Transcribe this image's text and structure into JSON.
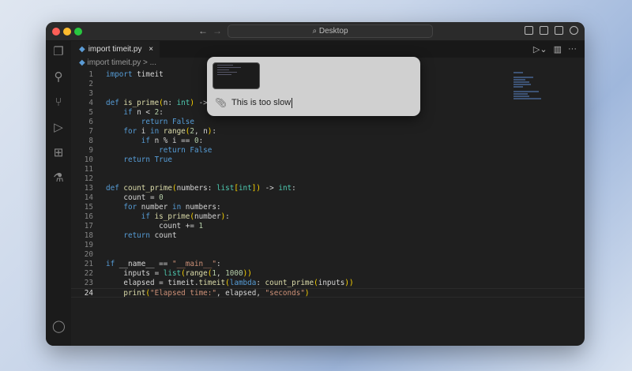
{
  "window": {
    "search": "Desktop"
  },
  "tab": {
    "label": "import timeit.py",
    "close": "×"
  },
  "breadcrumb": "import timeit.py > ...",
  "popup": {
    "input": "This is too slow"
  },
  "code": [
    [
      [
        "import ",
        "kw"
      ],
      [
        "timeit",
        "tx"
      ]
    ],
    [],
    [],
    [
      [
        "def ",
        "kw"
      ],
      [
        "is_prime",
        "fn"
      ],
      [
        "(",
        "pr"
      ],
      [
        "n: ",
        "tx"
      ],
      [
        "int",
        "ty"
      ],
      [
        ")",
        "pr"
      ],
      [
        " -> bool:",
        "tx"
      ]
    ],
    [
      [
        "    if ",
        "kw"
      ],
      [
        "n < ",
        "tx"
      ],
      [
        "2",
        "nb"
      ],
      [
        ":",
        "tx"
      ]
    ],
    [
      [
        "        return ",
        "kw"
      ],
      [
        "False",
        "kw"
      ]
    ],
    [
      [
        "    for ",
        "kw"
      ],
      [
        "i ",
        "tx"
      ],
      [
        "in ",
        "kw"
      ],
      [
        "range",
        "fn"
      ],
      [
        "(",
        "pr"
      ],
      [
        "2",
        "nb"
      ],
      [
        ", n",
        "tx"
      ],
      [
        ")",
        "pr"
      ],
      [
        ":",
        "tx"
      ]
    ],
    [
      [
        "        if ",
        "kw"
      ],
      [
        "n % i == ",
        "tx"
      ],
      [
        "0",
        "nb"
      ],
      [
        ":",
        "tx"
      ]
    ],
    [
      [
        "            return ",
        "kw"
      ],
      [
        "False",
        "kw"
      ]
    ],
    [
      [
        "    return ",
        "kw"
      ],
      [
        "True",
        "kw"
      ]
    ],
    [],
    [],
    [
      [
        "def ",
        "kw"
      ],
      [
        "count_prime",
        "fn"
      ],
      [
        "(",
        "pr"
      ],
      [
        "numbers: ",
        "tx"
      ],
      [
        "list",
        "ty"
      ],
      [
        "[",
        "pr"
      ],
      [
        "int",
        "ty"
      ],
      [
        "]",
        "pr"
      ],
      [
        ")",
        "pr"
      ],
      [
        " -> ",
        "tx"
      ],
      [
        "int",
        "ty"
      ],
      [
        ":",
        "tx"
      ]
    ],
    [
      [
        "    count = ",
        "tx"
      ],
      [
        "0",
        "nb"
      ]
    ],
    [
      [
        "    for ",
        "kw"
      ],
      [
        "number ",
        "tx"
      ],
      [
        "in ",
        "kw"
      ],
      [
        "numbers:",
        "tx"
      ]
    ],
    [
      [
        "        if ",
        "kw"
      ],
      [
        "is_prime",
        "fn"
      ],
      [
        "(",
        "pr"
      ],
      [
        "number",
        "tx"
      ],
      [
        ")",
        "pr"
      ],
      [
        ":",
        "tx"
      ]
    ],
    [
      [
        "            count += ",
        "tx"
      ],
      [
        "1",
        "nb"
      ]
    ],
    [
      [
        "    return ",
        "kw"
      ],
      [
        "count",
        "tx"
      ]
    ],
    [],
    [],
    [
      [
        "if ",
        "kw"
      ],
      [
        "__name__ == ",
        "tx"
      ],
      [
        "\"__main__\"",
        "st"
      ],
      [
        ":",
        "tx"
      ]
    ],
    [
      [
        "    inputs = ",
        "tx"
      ],
      [
        "list",
        "ty"
      ],
      [
        "(",
        "pr"
      ],
      [
        "range",
        "fn"
      ],
      [
        "(",
        "pr"
      ],
      [
        "1",
        "nb"
      ],
      [
        ", ",
        "tx"
      ],
      [
        "1000",
        "nb"
      ],
      [
        ")",
        "pr"
      ],
      [
        ")",
        "pr"
      ]
    ],
    [
      [
        "    elapsed = timeit.",
        "tx"
      ],
      [
        "timeit",
        "fn"
      ],
      [
        "(",
        "pr"
      ],
      [
        "lambda",
        "kw"
      ],
      [
        ": ",
        "tx"
      ],
      [
        "count_prime",
        "fn"
      ],
      [
        "(",
        "pr"
      ],
      [
        "inputs",
        "tx"
      ],
      [
        ")",
        "pr"
      ],
      [
        ")",
        "pr"
      ]
    ],
    [
      [
        "    ",
        "tx"
      ],
      [
        "print",
        "fn"
      ],
      [
        "(",
        "pr"
      ],
      [
        "\"Elapsed time:\"",
        "st"
      ],
      [
        ", elapsed, ",
        "tx"
      ],
      [
        "\"seconds\"",
        "st"
      ],
      [
        ")",
        "pr"
      ]
    ]
  ]
}
